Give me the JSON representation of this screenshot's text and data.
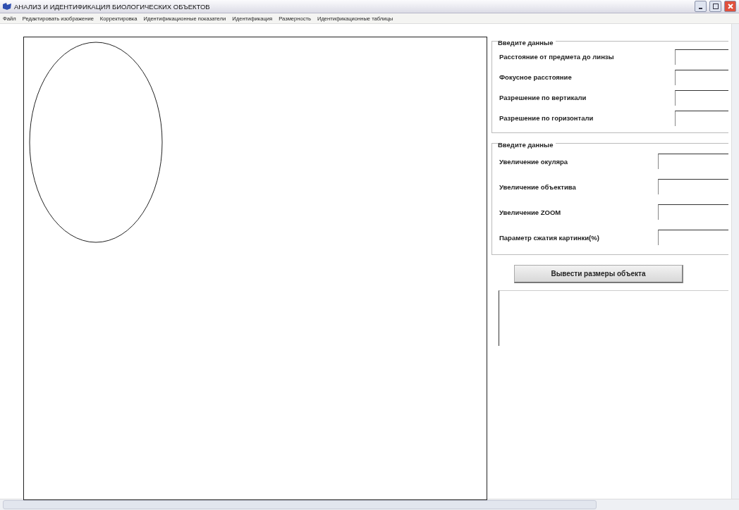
{
  "window": {
    "title": "АНАЛИЗ И ИДЕНТИФИКАЦИЯ БИОЛОГИЧЕСКИХ ОБЪЕКТОВ"
  },
  "menu": [
    "Файл",
    "Редактировать изображение",
    "Корректировка",
    "Идентификационные показатели",
    "Идентификация",
    "Размерность",
    "Идентификационные таблицы"
  ],
  "groups": [
    {
      "title": "Введите данные",
      "fields": [
        {
          "label": "Расстояние от предмета до линзы"
        },
        {
          "label": "Фокусное расстояние"
        },
        {
          "label": "Разрешение по вертикали"
        },
        {
          "label": "Разрешение по горизонтали"
        }
      ]
    },
    {
      "title": "Введите данные",
      "fields": [
        {
          "label": "Увеличение окуляра"
        },
        {
          "label": "Увеличение объектива"
        },
        {
          "label": "Увеличение ZOOM"
        },
        {
          "label": "Параметр сжатия картинки(%)"
        }
      ]
    }
  ],
  "button": "Вывести размеры объекта"
}
